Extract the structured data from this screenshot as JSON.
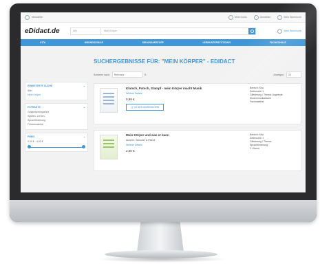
{
  "top": {
    "left_label": "Newsletter",
    "links": [
      "Mein Konto",
      "Anmelden",
      "Mein Warenkorb"
    ]
  },
  "header": {
    "logo": "eDidact.de",
    "search_select": "Alle",
    "search_value": "Mein Körper",
    "cart_label": "Mein Warenkorb"
  },
  "nav": {
    "items": [
      "KITA",
      "GRUNDSCHULE",
      "SEKUNDARSTUFE",
      "LERNUNTERSTÜTZUNG",
      "FACHSCHULE"
    ]
  },
  "main": {
    "title": "SUCHERGEBNISSE FÜR: \"MEIN KÖRPER\" - EDIDACT",
    "sort_label": "Sortieren nach:",
    "sort_value": "Relevanz",
    "show_label": "Anzeigen:",
    "show_value": "20"
  },
  "sidebar": {
    "box1": {
      "title": "ERWEITERTE SUCHE",
      "rows": [
        "Alle",
        "Mein Körper"
      ]
    },
    "box2": {
      "title": "EXTRAKTE",
      "rows": [
        "Gesamtpreisspanne",
        "Spielen, Lernen",
        "Sprachförderung",
        "Fördermaterial"
      ]
    },
    "box3": {
      "title": "PREIS",
      "range": "0,00 € - 4,00 €"
    }
  },
  "products": [
    {
      "title": "Klatsch, Patsch, Stampf - mein Körper macht Musik",
      "link": "Weitere Details",
      "price": "0,99 €",
      "button": "IN DEN WARENKORB",
      "meta": [
        "Bereich: Kita",
        "Seitenzahl: 1",
        "Gliederung / Thema: Angebote",
        "Kinder/musikalische",
        "Fachmaterial"
      ]
    },
    {
      "title": "Mein Körper und was er kann",
      "authors": "Autoren: Schuster & Reindl",
      "link": "Weitere Details",
      "price": "2,50 €",
      "meta": [
        "Bereich: Kita",
        "Seitenzahl: 1",
        "Gliederung / Thema:",
        "Sprachförderung",
        "1. Ebene"
      ]
    }
  ]
}
